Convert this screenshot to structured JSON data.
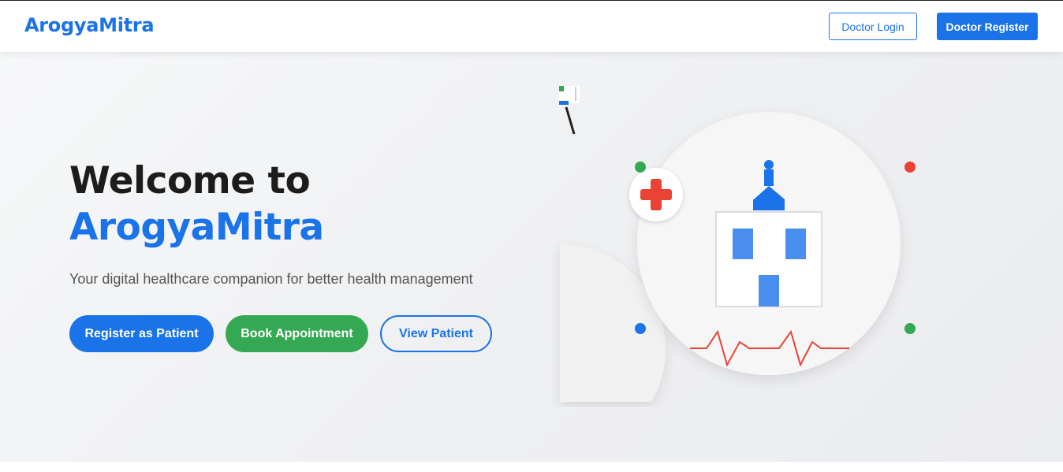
{
  "navbar": {
    "brand": "ArogyaMitra",
    "doctor_login": "Doctor Login",
    "doctor_register": "Doctor Register"
  },
  "hero": {
    "title_line1": "Welcome to",
    "title_line2": "ArogyaMitra",
    "tagline": "Your digital healthcare companion for better health management",
    "buttons": {
      "register_patient": "Register as Patient",
      "book_appointment": "Book Appointment",
      "view_patient": "View Patient"
    }
  },
  "colors": {
    "primary": "#1a73e8",
    "success": "#34a853",
    "danger": "#ea4335",
    "dark_text": "#1c1c1c"
  },
  "illustration": {
    "icons": [
      "hospital-icon",
      "medical-cross-icon",
      "heartbeat-line-icon",
      "doctor-figure-icon"
    ]
  }
}
